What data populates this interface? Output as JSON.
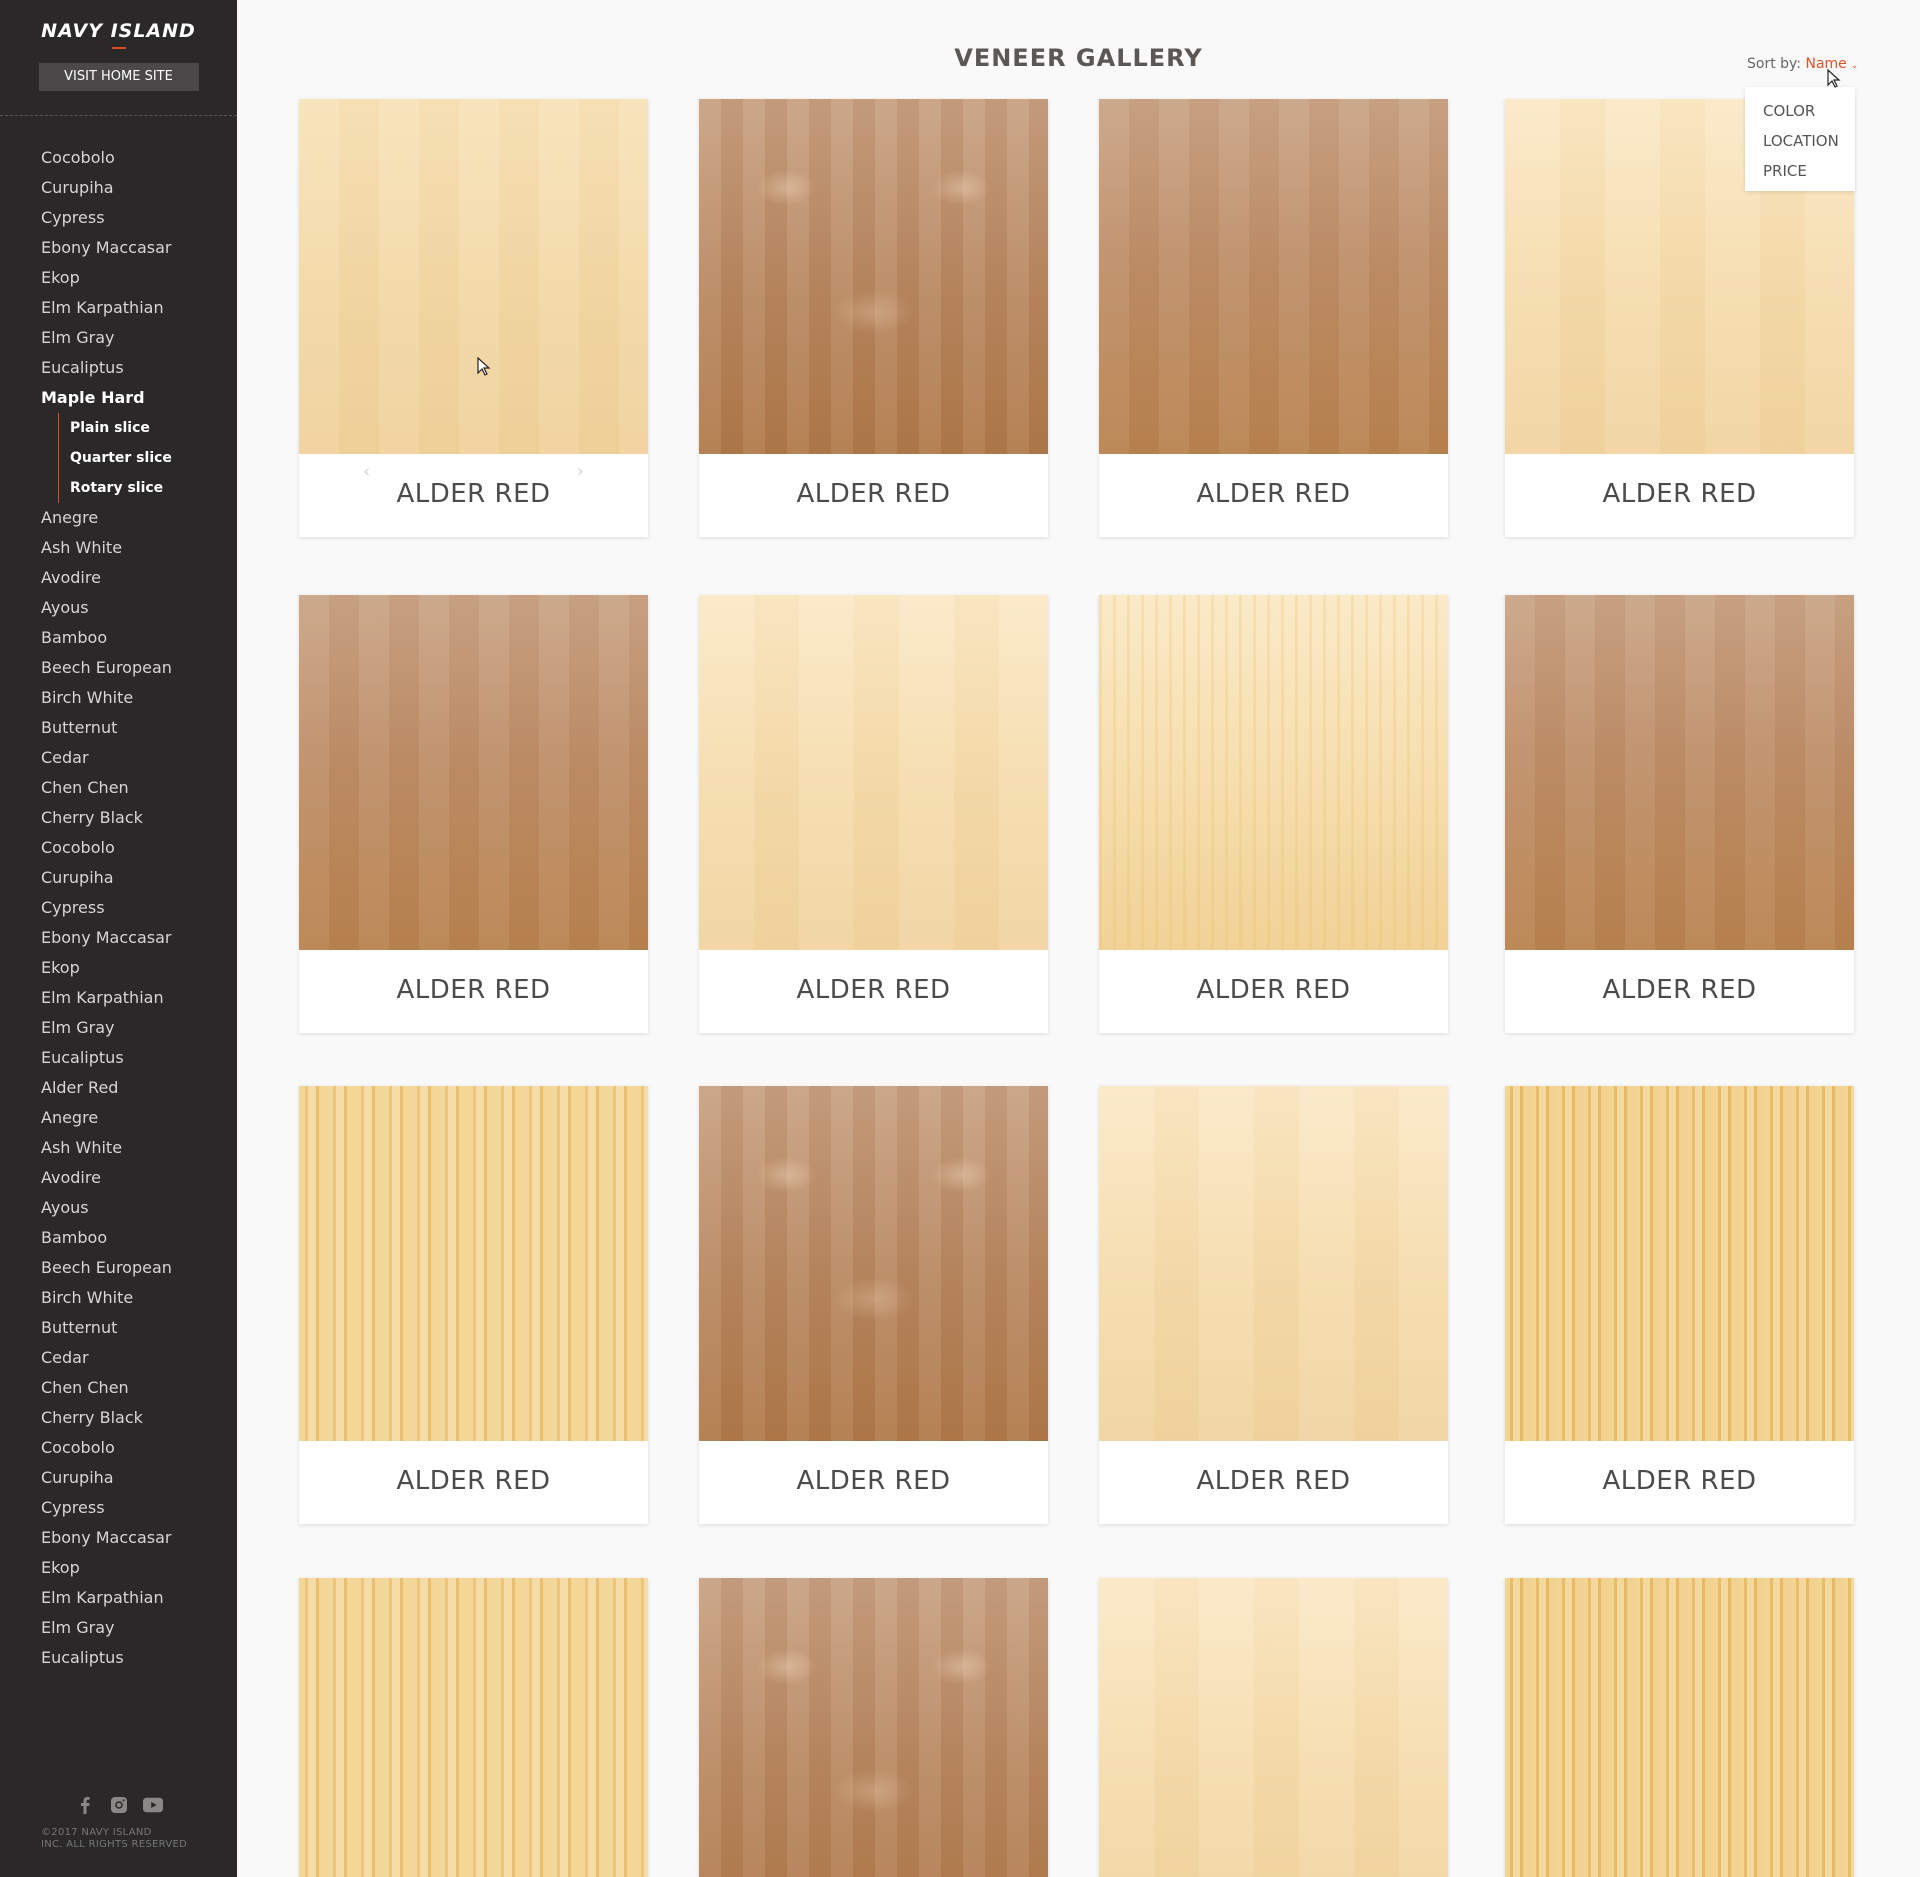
{
  "sidebar": {
    "logo": "NAVY ISLAND",
    "visit_button": "VISIT HOME SITE",
    "items_before": [
      "Cocobolo",
      "Curupiha",
      "Cypress",
      "Ebony Maccasar",
      "Ekop",
      "Elm Karpathian",
      "Elm Gray",
      "Eucaliptus"
    ],
    "active_item": "Maple Hard",
    "sub_items": [
      "Plain slice",
      "Quarter slice",
      "Rotary slice"
    ],
    "items_after": [
      "Anegre",
      "Ash White",
      "Avodire",
      "Ayous",
      "Bamboo",
      "Beech European",
      "Birch White",
      "Butternut",
      "Cedar",
      "Chen Chen",
      "Cherry Black",
      "Cocobolo",
      "Curupiha",
      "Cypress",
      "Ebony Maccasar",
      "Ekop",
      "Elm Karpathian",
      "Elm Gray",
      "Eucaliptus",
      "Alder Red",
      "Anegre",
      "Ash White",
      "Avodire",
      "Ayous",
      "Bamboo",
      "Beech European",
      "Birch White",
      "Butternut",
      "Cedar",
      "Chen Chen",
      "Cherry Black",
      "Cocobolo",
      "Curupiha",
      "Cypress",
      "Ebony Maccasar",
      "Ekop",
      "Elm Karpathian",
      "Elm Gray",
      "Eucaliptus"
    ],
    "social_icons": [
      "facebook-icon",
      "instagram-icon",
      "youtube-icon"
    ],
    "copyright_line1": "©2017 NAVY ISLAND",
    "copyright_line2": "INC. ALL RIGHTS RESERVED"
  },
  "main": {
    "title": "VENEER GALLERY",
    "sort": {
      "label": "Sort by:",
      "value": "Name",
      "options": [
        "COLOR",
        "LOCATION",
        "PRICE"
      ]
    },
    "cards": [
      {
        "label": "ALDER RED",
        "texture": "light"
      },
      {
        "label": "ALDER RED",
        "texture": "figured"
      },
      {
        "label": "ALDER RED",
        "texture": "brown"
      },
      {
        "label": "ALDER RED",
        "texture": "pale"
      },
      {
        "label": "ALDER RED",
        "texture": "brown"
      },
      {
        "label": "ALDER RED",
        "texture": "pale"
      },
      {
        "label": "ALDER RED",
        "texture": "flame"
      },
      {
        "label": "ALDER RED",
        "texture": "brown"
      },
      {
        "label": "ALDER RED",
        "texture": "striped"
      },
      {
        "label": "ALDER RED",
        "texture": "figured"
      },
      {
        "label": "ALDER RED",
        "texture": "pale"
      },
      {
        "label": "ALDER RED",
        "texture": "amber"
      },
      {
        "label": "",
        "texture": "striped"
      },
      {
        "label": "",
        "texture": "figured"
      },
      {
        "label": "",
        "texture": "pale"
      },
      {
        "label": "",
        "texture": "amber"
      }
    ]
  },
  "colors": {
    "sidebar_bg": "#2a2828",
    "accent": "#e0512b",
    "page_bg": "#f9f9f9"
  }
}
